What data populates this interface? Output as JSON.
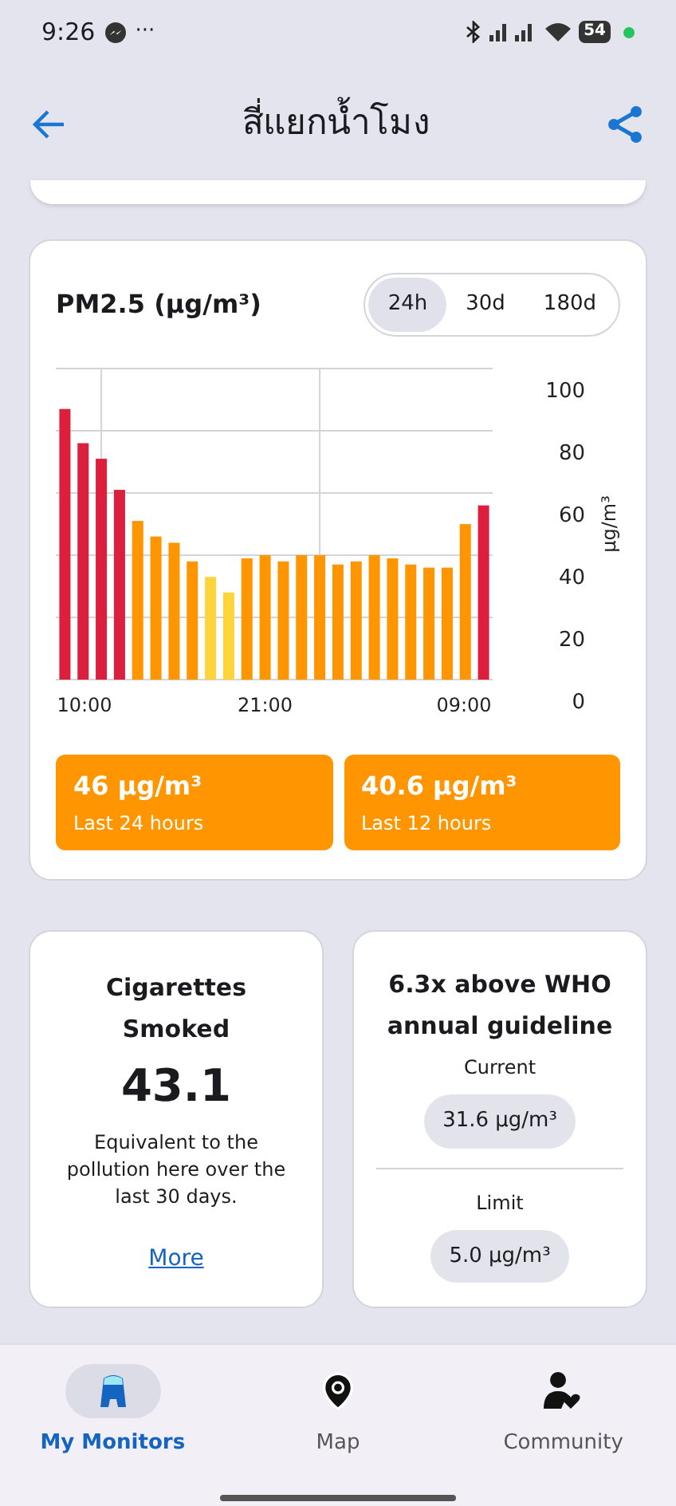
{
  "status_bar": {
    "time": "9:26",
    "more": "···",
    "battery": "54"
  },
  "header": {
    "title": "สี่แยกน้ำโมง"
  },
  "pm_card": {
    "title": "PM2.5 (µg/m³)",
    "ranges": [
      {
        "label": "24h",
        "selected": true
      },
      {
        "label": "30d",
        "selected": false
      },
      {
        "label": "180d",
        "selected": false
      }
    ],
    "chart_data": {
      "type": "bar",
      "grid": true,
      "ylabel": "µg/m³",
      "categories": [
        null,
        "10:00",
        null,
        null,
        null,
        null,
        null,
        null,
        null,
        null,
        null,
        "21:00",
        null,
        null,
        null,
        null,
        null,
        null,
        null,
        null,
        null,
        null,
        "09:00",
        null
      ],
      "ylim": [
        0,
        100
      ],
      "yticks": [
        0,
        20,
        40,
        60,
        80,
        100
      ],
      "series": [
        {
          "color": "#dc1f3c",
          "values": [
            87,
            76,
            71,
            61,
            null,
            null,
            null,
            null,
            null,
            null,
            null,
            null,
            null,
            null,
            null,
            null,
            null,
            null,
            null,
            null,
            null,
            null,
            null,
            56
          ]
        },
        {
          "color": "#ff9500",
          "values": [
            null,
            null,
            null,
            null,
            51,
            46,
            44,
            38,
            null,
            null,
            39,
            40,
            38,
            40,
            40,
            37,
            38,
            40,
            39,
            37,
            36,
            36,
            50,
            null
          ]
        },
        {
          "color": "#ffd43b",
          "values": [
            null,
            null,
            null,
            null,
            null,
            null,
            null,
            null,
            33,
            28,
            null,
            null,
            null,
            null,
            null,
            null,
            null,
            null,
            null,
            null,
            null,
            null,
            null,
            null
          ]
        }
      ]
    },
    "averages": [
      {
        "value": "46 µg/m³",
        "label": "Last 24 hours",
        "color": "#ff9500"
      },
      {
        "value": "40.6 µg/m³",
        "label": "Last 12 hours",
        "color": "#ff9500"
      }
    ]
  },
  "cigarettes": {
    "title": "Cigarettes Smoked",
    "value": "43.1",
    "description": "Equivalent to the pollution here over the last 30 days.",
    "link": "More"
  },
  "who": {
    "title": "6.3x above WHO annual guideline",
    "current_label": "Current",
    "current_value": "31.6 µg/m³",
    "limit_label": "Limit",
    "limit_value": "5.0 µg/m³"
  },
  "nav": [
    {
      "label": "My Monitors",
      "kind": "monitor",
      "selected": true
    },
    {
      "label": "Map",
      "kind": "map",
      "selected": false
    },
    {
      "label": "Community",
      "kind": "community",
      "selected": false
    }
  ]
}
